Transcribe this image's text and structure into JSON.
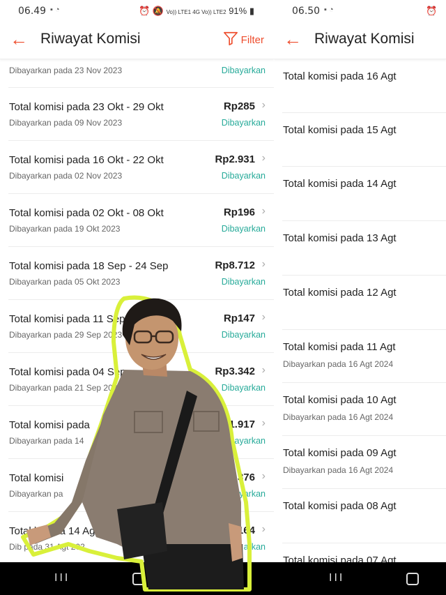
{
  "left": {
    "status": {
      "time": "06.49",
      "signal": "Vo)) LTE1 4G  Vo)) LTE2",
      "battery": "91%"
    },
    "title": "Riwayat Komisi",
    "filter_label": "Filter",
    "rows": [
      {
        "label": "",
        "date": "Dibayarkan pada 23 Nov 2023",
        "amount": "",
        "status": "Dibayarkan"
      },
      {
        "label": "Total komisi pada 23 Okt - 29 Okt",
        "date": "Dibayarkan pada 09 Nov 2023",
        "amount": "Rp285",
        "status": "Dibayarkan"
      },
      {
        "label": "Total komisi pada 16 Okt - 22 Okt",
        "date": "Dibayarkan pada 02 Nov 2023",
        "amount": "Rp2.931",
        "status": "Dibayarkan"
      },
      {
        "label": "Total komisi pada 02 Okt - 08 Okt",
        "date": "Dibayarkan pada 19 Okt 2023",
        "amount": "Rp196",
        "status": "Dibayarkan"
      },
      {
        "label": "Total komisi pada 18 Sep - 24 Sep",
        "date": "Dibayarkan pada 05 Okt 2023",
        "amount": "Rp8.712",
        "status": "Dibayarkan"
      },
      {
        "label": "Total komisi pada 11 Sep",
        "date": "Dibayarkan pada 29 Sep 2023",
        "amount": "Rp147",
        "status": "Dibayarkan"
      },
      {
        "label": "Total komisi pada 04 Sep -",
        "date": "Dibayarkan pada 21 Sep 2023",
        "amount": "Rp3.342",
        "status": "Dibayarkan"
      },
      {
        "label": "Total komisi pada",
        "date": "Dibayarkan pada 14",
        "amount": "1.917",
        "status": "ayarkan"
      },
      {
        "label": "Total komisi",
        "date": "Dibayarkan pa",
        "amount": "376",
        "status": "ayarkan"
      },
      {
        "label": "Total ko  ada 14 Ag",
        "date": "Dib  pada 31 Agt 202",
        "amount": "164",
        "status": "arkan"
      }
    ]
  },
  "right": {
    "status": {
      "time": "06.50"
    },
    "title": "Riwayat Komisi",
    "rows": [
      {
        "label": "Total komisi pada 16 Agt",
        "date": ""
      },
      {
        "label": "Total komisi pada 15 Agt",
        "date": ""
      },
      {
        "label": "Total komisi pada 14 Agt",
        "date": ""
      },
      {
        "label": "Total komisi pada 13 Agt",
        "date": ""
      },
      {
        "label": "Total komisi pada 12 Agt",
        "date": ""
      },
      {
        "label": "Total komisi pada 11 Agt",
        "date": "Dibayarkan pada 16 Agt 2024"
      },
      {
        "label": "Total komisi pada 10 Agt",
        "date": "Dibayarkan pada 16 Agt 2024"
      },
      {
        "label": "Total komisi pada 09 Agt",
        "date": "Dibayarkan pada 16 Agt 2024"
      },
      {
        "label": "Total komisi pada 08 Agt",
        "date": ""
      },
      {
        "label": "Total komisi pada 07 Agt",
        "date": ""
      }
    ]
  },
  "navbar": {
    "recents_icon": "recents-icon",
    "home_icon": "home-icon"
  },
  "colors": {
    "accent": "#ee4d2d",
    "paid": "#26aa99"
  }
}
